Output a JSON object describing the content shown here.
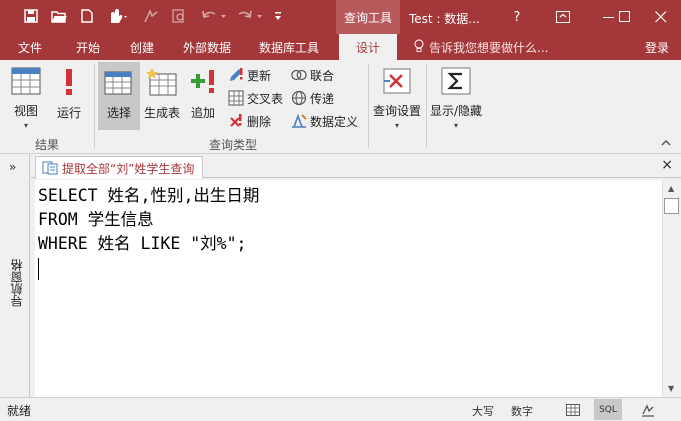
{
  "window": {
    "context_tab": "查询工具",
    "title": "Test : 数据...",
    "help": "?"
  },
  "ribbon_tabs": [
    {
      "label": "文件"
    },
    {
      "label": "开始"
    },
    {
      "label": "创建"
    },
    {
      "label": "外部数据"
    },
    {
      "label": "数据库工具"
    },
    {
      "label": "设计"
    }
  ],
  "tell_me": "告诉我您想要做什么...",
  "login": "登录",
  "ribbon": {
    "results": {
      "view": "视图",
      "run": "运行",
      "group_label": "结果"
    },
    "query_type": {
      "select": "选择",
      "make_table": "生成表",
      "append": "追加",
      "update": "更新",
      "crosstab": "交叉表",
      "delete": "删除",
      "union": "联合",
      "pass_through": "传递",
      "data_definition": "数据定义",
      "group_label": "查询类型"
    },
    "query_setup": "查询设置",
    "show_hide": "显示/隐藏"
  },
  "nav_pane": {
    "label": "导航窗格",
    "expand": "»"
  },
  "document": {
    "tab_label": "提取全部“刘”姓学生查询",
    "close": "×",
    "sql_lines": [
      "SELECT 姓名,性别,出生日期",
      "FROM 学生信息",
      "WHERE 姓名 LIKE \"刘%\";"
    ]
  },
  "status": {
    "ready": "就绪",
    "caps": "大写",
    "num": "数字",
    "sql_view": "SQL"
  },
  "colors": {
    "accent": "#a4373a",
    "context_tab": "#b8595c"
  }
}
